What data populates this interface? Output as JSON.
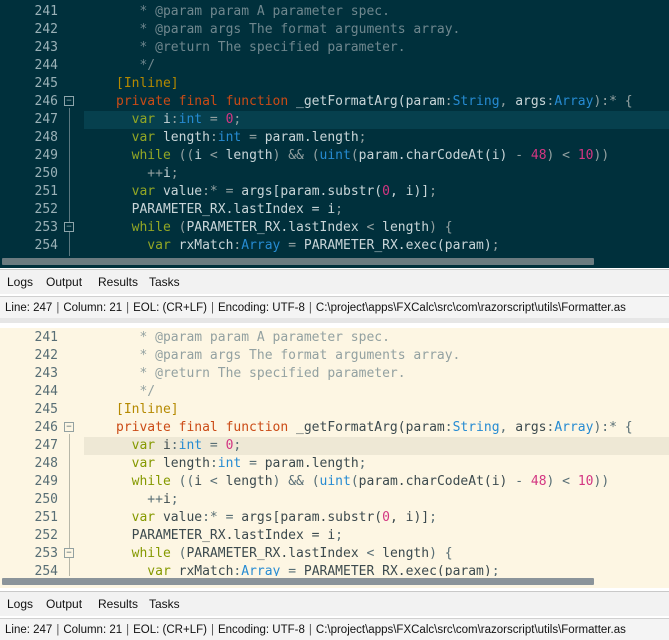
{
  "panes": [
    {
      "id": "dark",
      "theme": "solarized-dark",
      "lines": [
        {
          "num": "241",
          "fold": "",
          "current": false,
          "tokens": [
            [
              "c-comment",
              "   * @param param A parameter spec."
            ]
          ]
        },
        {
          "num": "242",
          "fold": "",
          "current": false,
          "tokens": [
            [
              "c-comment",
              "   * @param args The format arguments array."
            ]
          ]
        },
        {
          "num": "243",
          "fold": "",
          "current": false,
          "tokens": [
            [
              "c-comment",
              "   * @return The specified parameter."
            ]
          ]
        },
        {
          "num": "244",
          "fold": "",
          "current": false,
          "tokens": [
            [
              "c-comment",
              "   */"
            ]
          ]
        },
        {
          "num": "245",
          "fold": "",
          "current": false,
          "tokens": [
            [
              "c-attr",
              "[Inline]"
            ]
          ]
        },
        {
          "num": "246",
          "fold": "−",
          "current": false,
          "tokens": [
            [
              "c-decl",
              "private final function "
            ],
            [
              "c-func",
              "_getFormatArg("
            ],
            [
              "c-ident",
              "param"
            ],
            [
              "c-op",
              ":"
            ],
            [
              "c-type",
              "String"
            ],
            [
              "c-op",
              ", "
            ],
            [
              "c-ident",
              "args"
            ],
            [
              "c-op",
              ":"
            ],
            [
              "c-type",
              "Array"
            ],
            [
              "c-op",
              "):* {"
            ]
          ]
        },
        {
          "num": "247",
          "fold": "",
          "current": true,
          "tokens": [
            [
              "c-keyword",
              "  var "
            ],
            [
              "c-ident",
              "i"
            ],
            [
              "c-op",
              ":"
            ],
            [
              "c-type",
              "int"
            ],
            [
              "c-op",
              " = "
            ],
            [
              "c-num",
              "0"
            ],
            [
              "c-op",
              ";"
            ]
          ]
        },
        {
          "num": "248",
          "fold": "",
          "current": false,
          "tokens": [
            [
              "c-keyword",
              "  var "
            ],
            [
              "c-ident",
              "length"
            ],
            [
              "c-op",
              ":"
            ],
            [
              "c-type",
              "int"
            ],
            [
              "c-op",
              " = "
            ],
            [
              "c-ident",
              "param.length"
            ],
            [
              "c-op",
              ";"
            ]
          ]
        },
        {
          "num": "249",
          "fold": "",
          "current": false,
          "tokens": [
            [
              "c-keyword",
              "  while "
            ],
            [
              "c-op",
              "(("
            ],
            [
              "c-ident",
              "i"
            ],
            [
              "c-op",
              " < "
            ],
            [
              "c-ident",
              "length"
            ],
            [
              "c-op",
              ") && ("
            ],
            [
              "c-type",
              "uint"
            ],
            [
              "c-op",
              "("
            ],
            [
              "c-ident",
              "param.charCodeAt(i)"
            ],
            [
              "c-op",
              " - "
            ],
            [
              "c-num",
              "48"
            ],
            [
              "c-op",
              ") < "
            ],
            [
              "c-num",
              "10"
            ],
            [
              "c-op",
              "))"
            ]
          ]
        },
        {
          "num": "250",
          "fold": "",
          "current": false,
          "tokens": [
            [
              "c-op",
              "    ++"
            ],
            [
              "c-ident",
              "i"
            ],
            [
              "c-op",
              ";"
            ]
          ]
        },
        {
          "num": "251",
          "fold": "",
          "current": false,
          "tokens": [
            [
              "c-keyword",
              "  var "
            ],
            [
              "c-ident",
              "value"
            ],
            [
              "c-op",
              ":* = "
            ],
            [
              "c-ident",
              "args[param.substr("
            ],
            [
              "c-num",
              "0"
            ],
            [
              "c-ident",
              ", i)]"
            ],
            [
              "c-op",
              ";"
            ]
          ]
        },
        {
          "num": "252",
          "fold": "",
          "current": false,
          "tokens": [
            [
              "c-ident",
              "  PARAMETER_RX.lastIndex = i"
            ],
            [
              "c-op",
              ";"
            ]
          ]
        },
        {
          "num": "253",
          "fold": "−",
          "current": false,
          "tokens": [
            [
              "c-keyword",
              "  while "
            ],
            [
              "c-op",
              "("
            ],
            [
              "c-ident",
              "PARAMETER_RX.lastIndex"
            ],
            [
              "c-op",
              " < "
            ],
            [
              "c-ident",
              "length"
            ],
            [
              "c-op",
              ") {"
            ]
          ]
        },
        {
          "num": "254",
          "fold": "",
          "current": false,
          "tokens": [
            [
              "c-keyword",
              "    var "
            ],
            [
              "c-ident",
              "rxMatch"
            ],
            [
              "c-op",
              ":"
            ],
            [
              "c-type",
              "Array"
            ],
            [
              "c-op",
              " = "
            ],
            [
              "c-ident",
              "PARAMETER_RX.exec(param)"
            ],
            [
              "c-op",
              ";"
            ]
          ]
        }
      ]
    },
    {
      "id": "light",
      "theme": "solarized-light",
      "lines": [
        {
          "num": "241",
          "fold": "",
          "current": false,
          "tokens": [
            [
              "c-comment",
              "   * @param param A parameter spec."
            ]
          ]
        },
        {
          "num": "242",
          "fold": "",
          "current": false,
          "tokens": [
            [
              "c-comment",
              "   * @param args The format arguments array."
            ]
          ]
        },
        {
          "num": "243",
          "fold": "",
          "current": false,
          "tokens": [
            [
              "c-comment",
              "   * @return The specified parameter."
            ]
          ]
        },
        {
          "num": "244",
          "fold": "",
          "current": false,
          "tokens": [
            [
              "c-comment",
              "   */"
            ]
          ]
        },
        {
          "num": "245",
          "fold": "",
          "current": false,
          "tokens": [
            [
              "c-attr",
              "[Inline]"
            ]
          ]
        },
        {
          "num": "246",
          "fold": "−",
          "current": false,
          "tokens": [
            [
              "c-decl",
              "private final function "
            ],
            [
              "c-func",
              "_getFormatArg("
            ],
            [
              "c-ident",
              "param"
            ],
            [
              "c-op",
              ":"
            ],
            [
              "c-type",
              "String"
            ],
            [
              "c-op",
              ", "
            ],
            [
              "c-ident",
              "args"
            ],
            [
              "c-op",
              ":"
            ],
            [
              "c-type",
              "Array"
            ],
            [
              "c-op",
              "):* {"
            ]
          ]
        },
        {
          "num": "247",
          "fold": "",
          "current": true,
          "tokens": [
            [
              "c-keyword",
              "  var "
            ],
            [
              "c-ident",
              "i"
            ],
            [
              "c-op",
              ":"
            ],
            [
              "c-type",
              "int"
            ],
            [
              "c-op",
              " = "
            ],
            [
              "c-num",
              "0"
            ],
            [
              "c-op",
              ";"
            ]
          ]
        },
        {
          "num": "248",
          "fold": "",
          "current": false,
          "tokens": [
            [
              "c-keyword",
              "  var "
            ],
            [
              "c-ident",
              "length"
            ],
            [
              "c-op",
              ":"
            ],
            [
              "c-type",
              "int"
            ],
            [
              "c-op",
              " = "
            ],
            [
              "c-ident",
              "param.length"
            ],
            [
              "c-op",
              ";"
            ]
          ]
        },
        {
          "num": "249",
          "fold": "",
          "current": false,
          "tokens": [
            [
              "c-keyword",
              "  while "
            ],
            [
              "c-op",
              "(("
            ],
            [
              "c-ident",
              "i"
            ],
            [
              "c-op",
              " < "
            ],
            [
              "c-ident",
              "length"
            ],
            [
              "c-op",
              ") && ("
            ],
            [
              "c-type",
              "uint"
            ],
            [
              "c-op",
              "("
            ],
            [
              "c-ident",
              "param.charCodeAt(i)"
            ],
            [
              "c-op",
              " - "
            ],
            [
              "c-num",
              "48"
            ],
            [
              "c-op",
              ") < "
            ],
            [
              "c-num",
              "10"
            ],
            [
              "c-op",
              "))"
            ]
          ]
        },
        {
          "num": "250",
          "fold": "",
          "current": false,
          "tokens": [
            [
              "c-op",
              "    ++"
            ],
            [
              "c-ident",
              "i"
            ],
            [
              "c-op",
              ";"
            ]
          ]
        },
        {
          "num": "251",
          "fold": "",
          "current": false,
          "tokens": [
            [
              "c-keyword",
              "  var "
            ],
            [
              "c-ident",
              "value"
            ],
            [
              "c-op",
              ":* = "
            ],
            [
              "c-ident",
              "args[param.substr("
            ],
            [
              "c-num",
              "0"
            ],
            [
              "c-ident",
              ", i)]"
            ],
            [
              "c-op",
              ";"
            ]
          ]
        },
        {
          "num": "252",
          "fold": "",
          "current": false,
          "tokens": [
            [
              "c-ident",
              "  PARAMETER_RX.lastIndex = i"
            ],
            [
              "c-op",
              ";"
            ]
          ]
        },
        {
          "num": "253",
          "fold": "−",
          "current": false,
          "tokens": [
            [
              "c-keyword",
              "  while "
            ],
            [
              "c-op",
              "("
            ],
            [
              "c-ident",
              "PARAMETER_RX.lastIndex"
            ],
            [
              "c-op",
              " < "
            ],
            [
              "c-ident",
              "length"
            ],
            [
              "c-op",
              ") {"
            ]
          ]
        },
        {
          "num": "254",
          "fold": "",
          "current": false,
          "tokens": [
            [
              "c-keyword",
              "    var "
            ],
            [
              "c-ident",
              "rxMatch"
            ],
            [
              "c-op",
              ":"
            ],
            [
              "c-type",
              "Array"
            ],
            [
              "c-op",
              " = "
            ],
            [
              "c-ident",
              "PARAMETER_RX.exec(param)"
            ],
            [
              "c-op",
              ";"
            ]
          ]
        }
      ]
    }
  ],
  "panel_tabs": [
    "Logs",
    "Output",
    "Results",
    "Tasks"
  ],
  "status": {
    "line": "Line: 247",
    "column": "Column: 21",
    "eol": "EOL: (CR+LF)",
    "encoding": "Encoding: UTF-8",
    "path": "C:\\project\\apps\\FXCalc\\src\\com\\razorscript\\utils\\Formatter.as"
  },
  "colors": {
    "dark_background": "#00303c",
    "light_background": "#fdf6e3",
    "keyword": "#859900",
    "declaration": "#cb4b16",
    "type": "#268bd2",
    "number": "#d33682",
    "attribute": "#b58900"
  }
}
